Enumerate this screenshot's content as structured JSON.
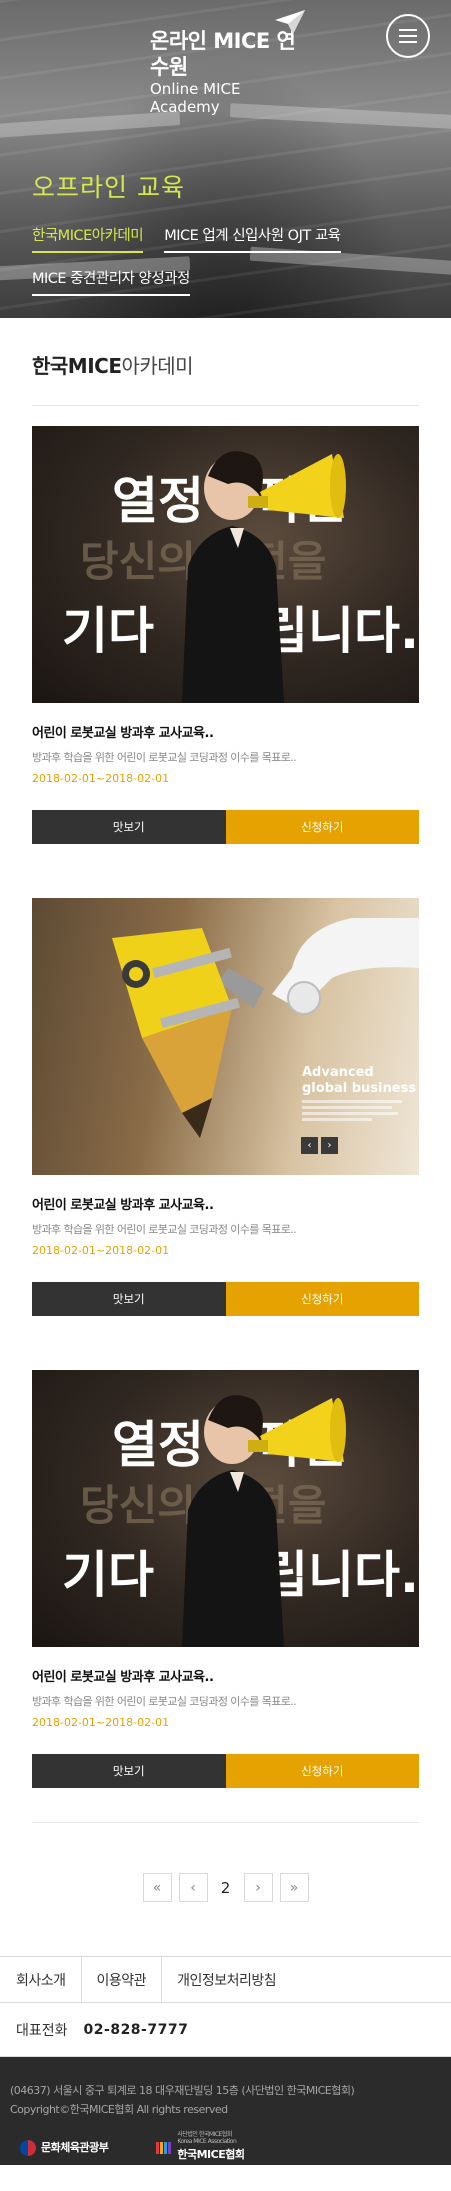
{
  "header": {
    "logo_title": "온라인 MICE 연수원",
    "logo_subtitle": "Online MICE Academy",
    "page_title": "오프라인 교육",
    "tabs": [
      {
        "label": "한국MICE아카데미",
        "active": true
      },
      {
        "label": "MICE 업계 신입사원 OJT 교육",
        "active": false
      },
      {
        "label": "MICE 중견관리자 양성과정",
        "active": false
      }
    ]
  },
  "section": {
    "title_bold": "한국MICE",
    "title_light": "아카데미"
  },
  "courses": [
    {
      "image": "megaphone-woman",
      "image_text": [
        "열정",
        "적인",
        "당신의 도전을",
        "기다",
        "립니다."
      ],
      "title": "어린이 로봇교실 방과후 교사교육..",
      "desc": "방과후 학습을 위한 어린이 로봇교실 코딩과정 이수를 목표로..",
      "date": "2018-02-01~2018-02-01",
      "preview_label": "맛보기",
      "apply_label": "신청하기"
    },
    {
      "image": "pencil-robot",
      "image_text": [
        "Advanced",
        "global business"
      ],
      "title": "어린이 로봇교실 방과후 교사교육..",
      "desc": "방과후 학습을 위한 어린이 로봇교실 코딩과정 이수를 목표로..",
      "date": "2018-02-01~2018-02-01",
      "preview_label": "맛보기",
      "apply_label": "신청하기"
    },
    {
      "image": "megaphone-woman",
      "image_text": [
        "열정",
        "적인",
        "당신의 도전을",
        "기다",
        "립니다."
      ],
      "title": "어린이 로봇교실 방과후 교사교육..",
      "desc": "방과후 학습을 위한 어린이 로봇교실 코딩과정 이수를 목표로..",
      "date": "2018-02-01~2018-02-01",
      "preview_label": "맛보기",
      "apply_label": "신청하기"
    }
  ],
  "pagination": {
    "first": "«",
    "prev": "‹",
    "current": "2",
    "next": "›",
    "last": "»"
  },
  "footer": {
    "links": [
      "회사소개",
      "이용약관",
      "개인정보처리방침"
    ],
    "phone_label": "대표전화",
    "phone_value": "02-828-7777",
    "address": "(04637) 서울시 중구 퇴계로 18 대우재단빌딩 15층 (사단법인 한국MICE협회)",
    "copyright": "Copyright©한국MICE협회 All rights reserved",
    "logo_ministry": "문화체육관광부",
    "logo_association_small": "사단법인 한국MICE협회",
    "logo_association_small_en": "Korea MICE Association",
    "logo_association": "한국MICE협회"
  },
  "colors": {
    "accent_yellow": "#e6a200",
    "hero_green": "#d6e84b",
    "dark_button": "#333333"
  }
}
